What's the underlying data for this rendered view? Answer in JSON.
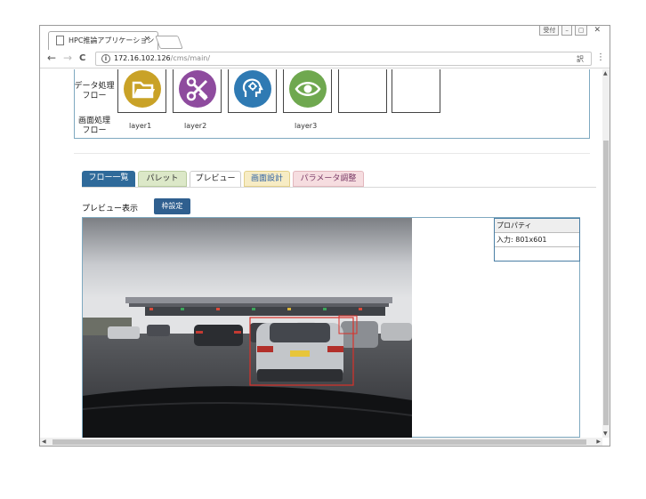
{
  "browser": {
    "tab_title": "HPC推論アプリケーション",
    "tab_close": "×",
    "win_buttons": [
      "受付",
      "–",
      "▢",
      "✕"
    ],
    "url_host": "172.16.102.126",
    "url_path": "/cms/main/",
    "back": "←",
    "forward": "→",
    "reload": "C",
    "info": "i",
    "translate": "訳",
    "menu": "⋮"
  },
  "flow": {
    "data_row_label": [
      "データ処理",
      "フロー"
    ],
    "image_row_label": [
      "画面処理",
      "フロー"
    ],
    "layers": [
      {
        "label": "layer1",
        "icon": "folder-icon",
        "color": "#c9a227"
      },
      {
        "label": "layer2",
        "icon": "tools-icon",
        "color": "#8e4b9e"
      },
      {
        "label": "",
        "icon": "brain-icon",
        "color": "#2f7ab3"
      },
      {
        "label": "layer3",
        "icon": "eye-icon",
        "color": "#6fa84f"
      },
      {
        "label": "",
        "icon": "",
        "color": ""
      },
      {
        "label": "",
        "icon": "",
        "color": ""
      }
    ]
  },
  "tabs": [
    {
      "label": "フロー一覧",
      "bg": "#2f6a9a",
      "fg": "#ffffff"
    },
    {
      "label": "パレット",
      "bg": "#dce8c8",
      "fg": "#333333"
    },
    {
      "label": "プレビュー",
      "bg": "#ffffff",
      "fg": "#222222"
    },
    {
      "label": "画面設計",
      "bg": "#f7ecc4",
      "fg": "#2b5fa3"
    },
    {
      "label": "パラメータ調整",
      "bg": "#f6dde0",
      "fg": "#7a3a66"
    }
  ],
  "preview": {
    "title": "プレビュー表示",
    "settings_button": "枠設定",
    "properties_header": "プロパティ",
    "input_label": "入力: 801x601"
  }
}
